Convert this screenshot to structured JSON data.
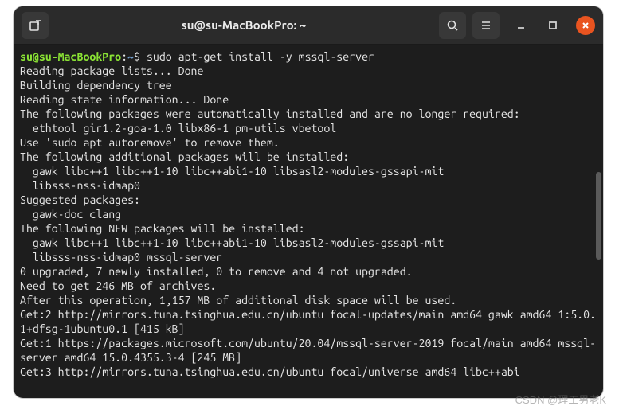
{
  "window": {
    "title": "su@su-MacBookPro: ~"
  },
  "prompt": {
    "user_host": "su@su-MacBookPro",
    "path": "~",
    "symbol": "$",
    "command": "sudo apt-get install -y mssql-server"
  },
  "output_lines": [
    "Reading package lists... Done",
    "Building dependency tree",
    "Reading state information... Done",
    "The following packages were automatically installed and are no longer required:",
    "  ethtool gir1.2-goa-1.0 libx86-1 pm-utils vbetool",
    "Use 'sudo apt autoremove' to remove them.",
    "The following additional packages will be installed:",
    "  gawk libc++1 libc++1-10 libc++abi1-10 libsasl2-modules-gssapi-mit",
    "  libsss-nss-idmap0",
    "Suggested packages:",
    "  gawk-doc clang",
    "The following NEW packages will be installed:",
    "  gawk libc++1 libc++1-10 libc++abi1-10 libsasl2-modules-gssapi-mit",
    "  libsss-nss-idmap0 mssql-server",
    "0 upgraded, 7 newly installed, 0 to remove and 4 not upgraded.",
    "Need to get 246 MB of archives.",
    "After this operation, 1,157 MB of additional disk space will be used.",
    "Get:2 http://mirrors.tuna.tsinghua.edu.cn/ubuntu focal-updates/main amd64 gawk amd64 1:5.0.1+dfsg-1ubuntu0.1 [415 kB]",
    "Get:1 https://packages.microsoft.com/ubuntu/20.04/mssql-server-2019 focal/main amd64 mssql-server amd64 15.0.4355.3-4 [245 MB]",
    "Get:3 http://mirrors.tuna.tsinghua.edu.cn/ubuntu focal/universe amd64 libc++abi"
  ],
  "watermark": "CSDN @理工男老K"
}
